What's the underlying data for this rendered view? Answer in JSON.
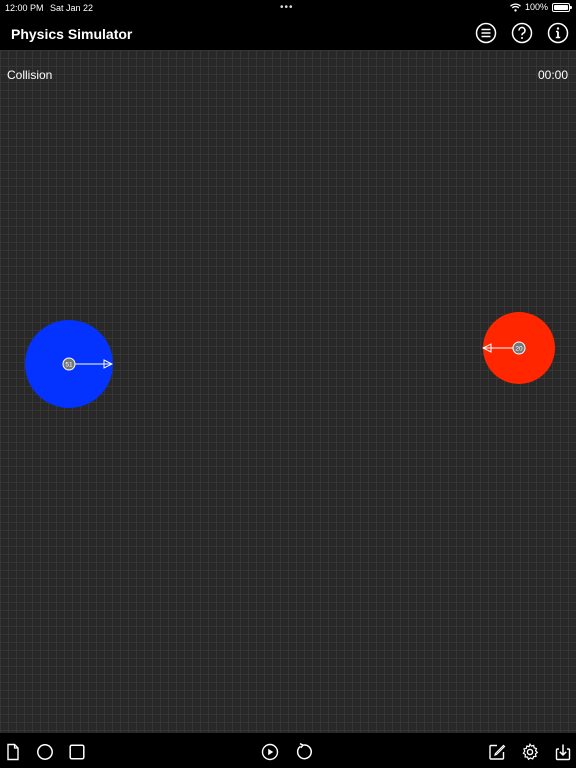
{
  "status": {
    "time": "12:00 PM",
    "date": "Sat Jan 22",
    "battery": "100%"
  },
  "nav": {
    "title": "Physics Simulator",
    "icons": [
      "list-icon",
      "help-icon",
      "info-icon"
    ]
  },
  "canvas": {
    "scene_name": "Collision",
    "timer": "00:00",
    "bodies": [
      {
        "label": "51",
        "color": "#0433FF",
        "velocity_direction": "right"
      },
      {
        "label": "20",
        "color": "#FF2600",
        "velocity_direction": "left"
      }
    ]
  },
  "toolbar": {
    "left": [
      "new-document-icon",
      "add-circle-icon",
      "add-square-icon"
    ],
    "center": [
      "play-icon",
      "reset-icon"
    ],
    "right": [
      "edit-icon",
      "settings-icon",
      "download-icon"
    ]
  }
}
